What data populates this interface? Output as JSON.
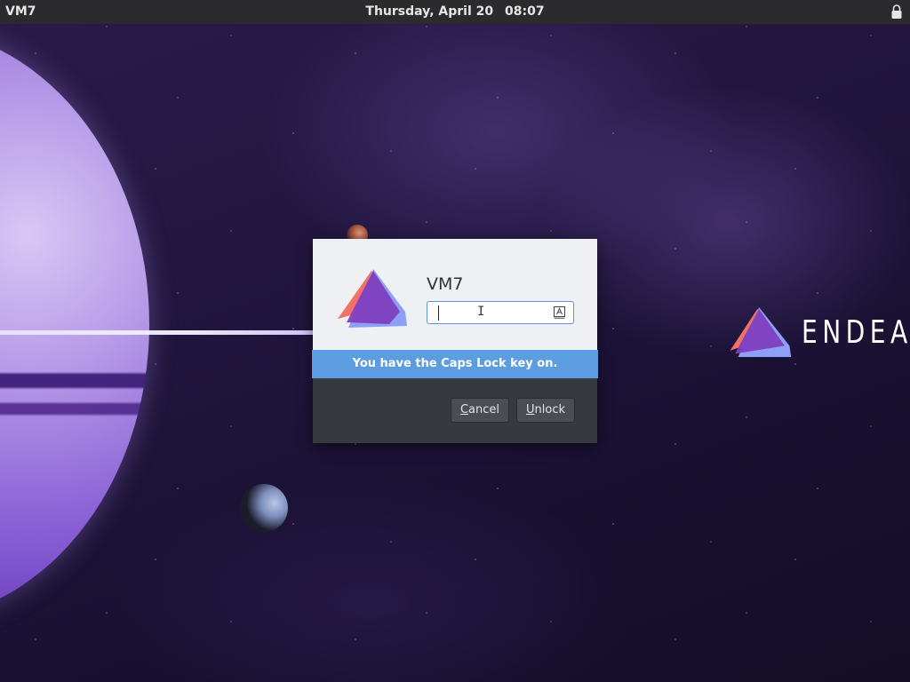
{
  "topbar": {
    "hostname": "VM7",
    "date": "Thursday, April 20",
    "time": "08:07",
    "status_icon": "lock-icon"
  },
  "wallpaper": {
    "brand_text": "ENDEAVOU",
    "brand_icon": "endeavour-logo-icon"
  },
  "dialog": {
    "username": "VM7",
    "avatar_icon": "endeavour-logo-icon",
    "password": {
      "value": "",
      "caps_lock_icon": "caps-lock-icon"
    },
    "banner": "You have the Caps Lock key on.",
    "buttons": {
      "cancel_mnemonic": "C",
      "cancel_rest": "ancel",
      "unlock_mnemonic": "U",
      "unlock_rest": "nlock"
    }
  },
  "colors": {
    "topbar_bg": "#2b2b2d",
    "banner_bg": "#5b9de0",
    "dialog_lower_bg": "#36393f",
    "input_border": "#5a95d8",
    "logo_red": "#f2706a",
    "logo_purple": "#7f3fbf",
    "logo_blue": "#8ea0f6"
  }
}
